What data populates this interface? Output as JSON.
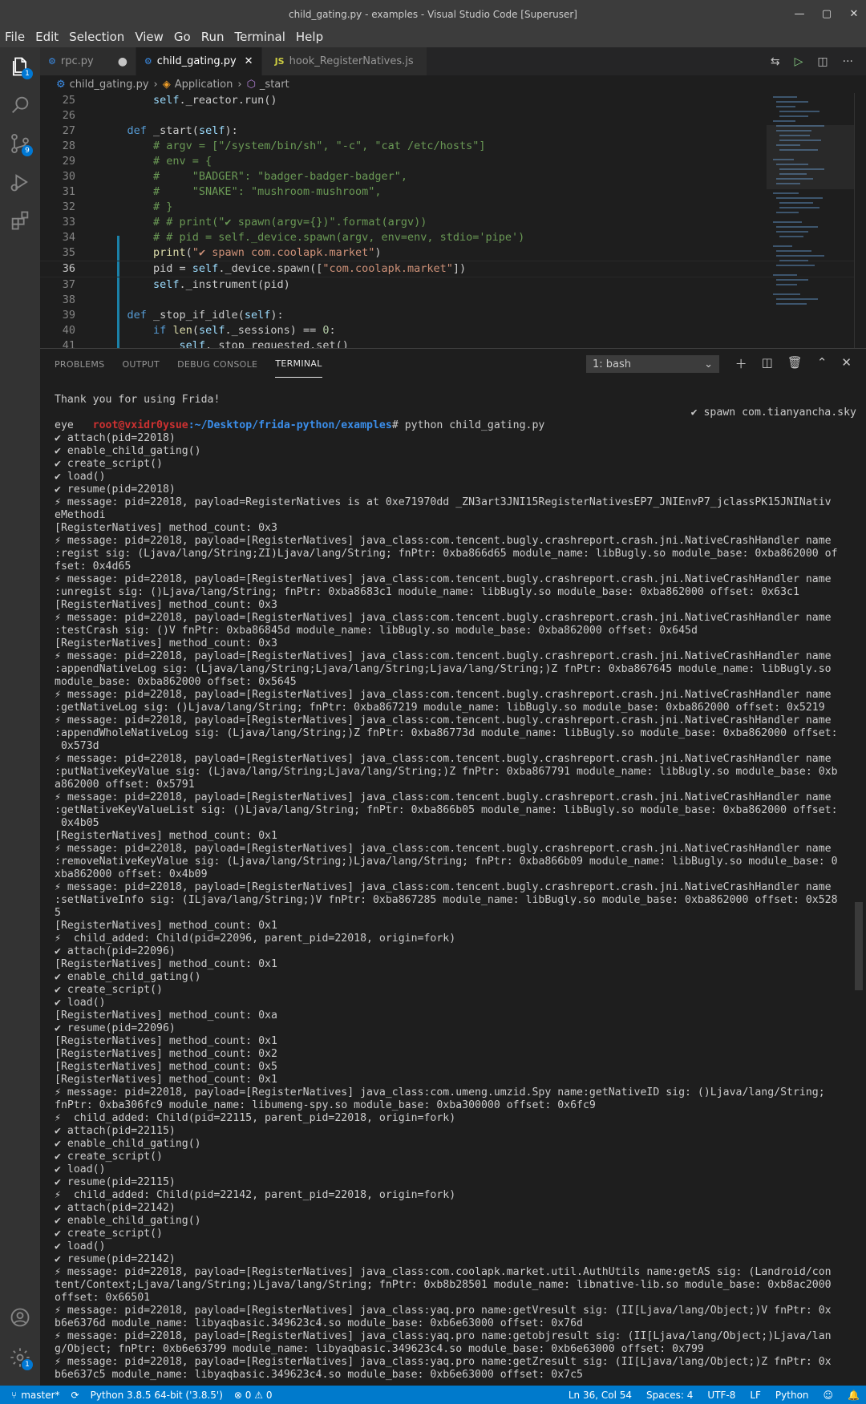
{
  "window": {
    "title": "child_gating.py - examples - Visual Studio Code [Superuser]"
  },
  "menu": [
    "File",
    "Edit",
    "Selection",
    "View",
    "Go",
    "Run",
    "Terminal",
    "Help"
  ],
  "activity": {
    "explorer_badge": "1",
    "scm_badge": "9",
    "settings_badge": "1"
  },
  "tabs": [
    {
      "label": "rpc.py",
      "modified": "●"
    },
    {
      "label": "child_gating.py",
      "close": "✕"
    },
    {
      "label": "hook_RegisterNatives.js",
      "icon": "JS"
    }
  ],
  "breadcrumb": {
    "file": "child_gating.py",
    "class": "Application",
    "method": "_start"
  },
  "editor": {
    "lines": [
      {
        "n": "25",
        "code": "        self._reactor.run()"
      },
      {
        "n": "26",
        "code": ""
      },
      {
        "n": "27",
        "code": "    def _start(self):"
      },
      {
        "n": "28",
        "code": "        # argv = [\"/system/bin/sh\", \"-c\", \"cat /etc/hosts\"]"
      },
      {
        "n": "29",
        "code": "        # env = {"
      },
      {
        "n": "30",
        "code": "        #     \"BADGER\": \"badger-badger-badger\","
      },
      {
        "n": "31",
        "code": "        #     \"SNAKE\": \"mushroom-mushroom\","
      },
      {
        "n": "32",
        "code": "        # }"
      },
      {
        "n": "33",
        "code": "        # # print(\"✔ spawn(argv={})\".format(argv))"
      },
      {
        "n": "34",
        "code": "        # # pid = self._device.spawn(argv, env=env, stdio='pipe')"
      },
      {
        "n": "35",
        "code": "        print(\"✔ spawn com.coolapk.market\")"
      },
      {
        "n": "36",
        "code": "        pid = self._device.spawn([\"com.coolapk.market\"])"
      },
      {
        "n": "37",
        "code": "        self._instrument(pid)"
      },
      {
        "n": "38",
        "code": ""
      },
      {
        "n": "39",
        "code": "    def _stop_if_idle(self):"
      },
      {
        "n": "40",
        "code": "        if len(self._sessions) == 0:"
      },
      {
        "n": "41",
        "code": "            self._stop_requested.set()"
      }
    ]
  },
  "panel": {
    "tabs": [
      "PROBLEMS",
      "OUTPUT",
      "DEBUG CONSOLE",
      "TERMINAL"
    ],
    "terminal_select": "1: bash"
  },
  "terminal": {
    "prompt_user": "root@vxidr0ysue",
    "prompt_path": ":~/Desktop/frida-python/examples",
    "prompt_cmd": "# python child_gating.py",
    "prompt_tail": "✔ spawn com.tianyancha.sky",
    "lines_before": [
      "Thank you for using Frida!"
    ],
    "lines": [
      "eye",
      "✔ attach(pid=22018)",
      "✔ enable_child_gating()",
      "✔ create_script()",
      "✔ load()",
      "✔ resume(pid=22018)",
      "⚡ message: pid=22018, payload=RegisterNatives is at 0xe71970dd _ZN3art3JNI15RegisterNativesEP7_JNIEnvP7_jclassPK15JNINativ",
      "eMethodi",
      "[RegisterNatives] method_count: 0x3",
      "⚡ message: pid=22018, payload=[RegisterNatives] java_class:com.tencent.bugly.crashreport.crash.jni.NativeCrashHandler name",
      ":regist sig: (Ljava/lang/String;ZI)Ljava/lang/String; fnPtr: 0xba866d65 module_name: libBugly.so module_base: 0xba862000 of",
      "fset: 0x4d65",
      "⚡ message: pid=22018, payload=[RegisterNatives] java_class:com.tencent.bugly.crashreport.crash.jni.NativeCrashHandler name",
      ":unregist sig: ()Ljava/lang/String; fnPtr: 0xba8683c1 module_name: libBugly.so module_base: 0xba862000 offset: 0x63c1",
      "[RegisterNatives] method_count: 0x3",
      "⚡ message: pid=22018, payload=[RegisterNatives] java_class:com.tencent.bugly.crashreport.crash.jni.NativeCrashHandler name",
      ":testCrash sig: ()V fnPtr: 0xba86845d module_name: libBugly.so module_base: 0xba862000 offset: 0x645d",
      "[RegisterNatives] method_count: 0x3",
      "⚡ message: pid=22018, payload=[RegisterNatives] java_class:com.tencent.bugly.crashreport.crash.jni.NativeCrashHandler name",
      ":appendNativeLog sig: (Ljava/lang/String;Ljava/lang/String;Ljava/lang/String;)Z fnPtr: 0xba867645 module_name: libBugly.so",
      "module_base: 0xba862000 offset: 0x5645",
      "⚡ message: pid=22018, payload=[RegisterNatives] java_class:com.tencent.bugly.crashreport.crash.jni.NativeCrashHandler name",
      ":getNativeLog sig: ()Ljava/lang/String; fnPtr: 0xba867219 module_name: libBugly.so module_base: 0xba862000 offset: 0x5219",
      "⚡ message: pid=22018, payload=[RegisterNatives] java_class:com.tencent.bugly.crashreport.crash.jni.NativeCrashHandler name",
      ":appendWholeNativeLog sig: (Ljava/lang/String;)Z fnPtr: 0xba86773d module_name: libBugly.so module_base: 0xba862000 offset:",
      " 0x573d",
      "⚡ message: pid=22018, payload=[RegisterNatives] java_class:com.tencent.bugly.crashreport.crash.jni.NativeCrashHandler name",
      ":putNativeKeyValue sig: (Ljava/lang/String;Ljava/lang/String;)Z fnPtr: 0xba867791 module_name: libBugly.so module_base: 0xb",
      "a862000 offset: 0x5791",
      "⚡ message: pid=22018, payload=[RegisterNatives] java_class:com.tencent.bugly.crashreport.crash.jni.NativeCrashHandler name",
      ":getNativeKeyValueList sig: ()Ljava/lang/String; fnPtr: 0xba866b05 module_name: libBugly.so module_base: 0xba862000 offset:",
      " 0x4b05",
      "[RegisterNatives] method_count: 0x1",
      "⚡ message: pid=22018, payload=[RegisterNatives] java_class:com.tencent.bugly.crashreport.crash.jni.NativeCrashHandler name",
      ":removeNativeKeyValue sig: (Ljava/lang/String;)Ljava/lang/String; fnPtr: 0xba866b09 module_name: libBugly.so module_base: 0",
      "xba862000 offset: 0x4b09",
      "⚡ message: pid=22018, payload=[RegisterNatives] java_class:com.tencent.bugly.crashreport.crash.jni.NativeCrashHandler name",
      ":setNativeInfo sig: (ILjava/lang/String;)V fnPtr: 0xba867285 module_name: libBugly.so module_base: 0xba862000 offset: 0x528",
      "5",
      "[RegisterNatives] method_count: 0x1",
      "⚡  child_added: Child(pid=22096, parent_pid=22018, origin=fork)",
      "✔ attach(pid=22096)",
      "[RegisterNatives] method_count: 0x1",
      "✔ enable_child_gating()",
      "✔ create_script()",
      "✔ load()",
      "[RegisterNatives] method_count: 0xa",
      "✔ resume(pid=22096)",
      "[RegisterNatives] method_count: 0x1",
      "[RegisterNatives] method_count: 0x2",
      "[RegisterNatives] method_count: 0x5",
      "[RegisterNatives] method_count: 0x1",
      "⚡ message: pid=22018, payload=[RegisterNatives] java_class:com.umeng.umzid.Spy name:getNativeID sig: ()Ljava/lang/String;",
      "fnPtr: 0xba306fc9 module_name: libumeng-spy.so module_base: 0xba300000 offset: 0x6fc9",
      "⚡  child_added: Child(pid=22115, parent_pid=22018, origin=fork)",
      "✔ attach(pid=22115)",
      "✔ enable_child_gating()",
      "✔ create_script()",
      "✔ load()",
      "✔ resume(pid=22115)",
      "⚡  child_added: Child(pid=22142, parent_pid=22018, origin=fork)",
      "✔ attach(pid=22142)",
      "✔ enable_child_gating()",
      "✔ create_script()",
      "✔ load()",
      "✔ resume(pid=22142)",
      "⚡ message: pid=22018, payload=[RegisterNatives] java_class:com.coolapk.market.util.AuthUtils name:getAS sig: (Landroid/con",
      "tent/Context;Ljava/lang/String;)Ljava/lang/String; fnPtr: 0xb8b28501 module_name: libnative-lib.so module_base: 0xb8ac2000",
      "offset: 0x66501",
      "⚡ message: pid=22018, payload=[RegisterNatives] java_class:yaq.pro name:getVresult sig: (II[Ljava/lang/Object;)V fnPtr: 0x",
      "b6e6376d module_name: libyaqbasic.349623c4.so module_base: 0xb6e63000 offset: 0x76d",
      "⚡ message: pid=22018, payload=[RegisterNatives] java_class:yaq.pro name:getobjresult sig: (II[Ljava/lang/Object;)Ljava/lan",
      "g/Object; fnPtr: 0xb6e63799 module_name: libyaqbasic.349623c4.so module_base: 0xb6e63000 offset: 0x799",
      "⚡ message: pid=22018, payload=[RegisterNatives] java_class:yaq.pro name:getZresult sig: (II[Ljava/lang/Object;)Z fnPtr: 0x",
      "b6e637c5 module_name: libyaqbasic.349623c4.so module_base: 0xb6e63000 offset: 0x7c5"
    ]
  },
  "statusbar": {
    "branch": "master*",
    "python": "Python 3.8.5 64-bit ('3.8.5')",
    "problems": "⊗ 0 ⚠ 0",
    "position": "Ln 36, Col 54",
    "spaces": "Spaces: 4",
    "encoding": "UTF-8",
    "eol": "LF",
    "language": "Python"
  },
  "colors": {
    "accent": "#007acc",
    "titlebar": "#3c3c3c",
    "editor_bg": "#1e1e1e"
  }
}
